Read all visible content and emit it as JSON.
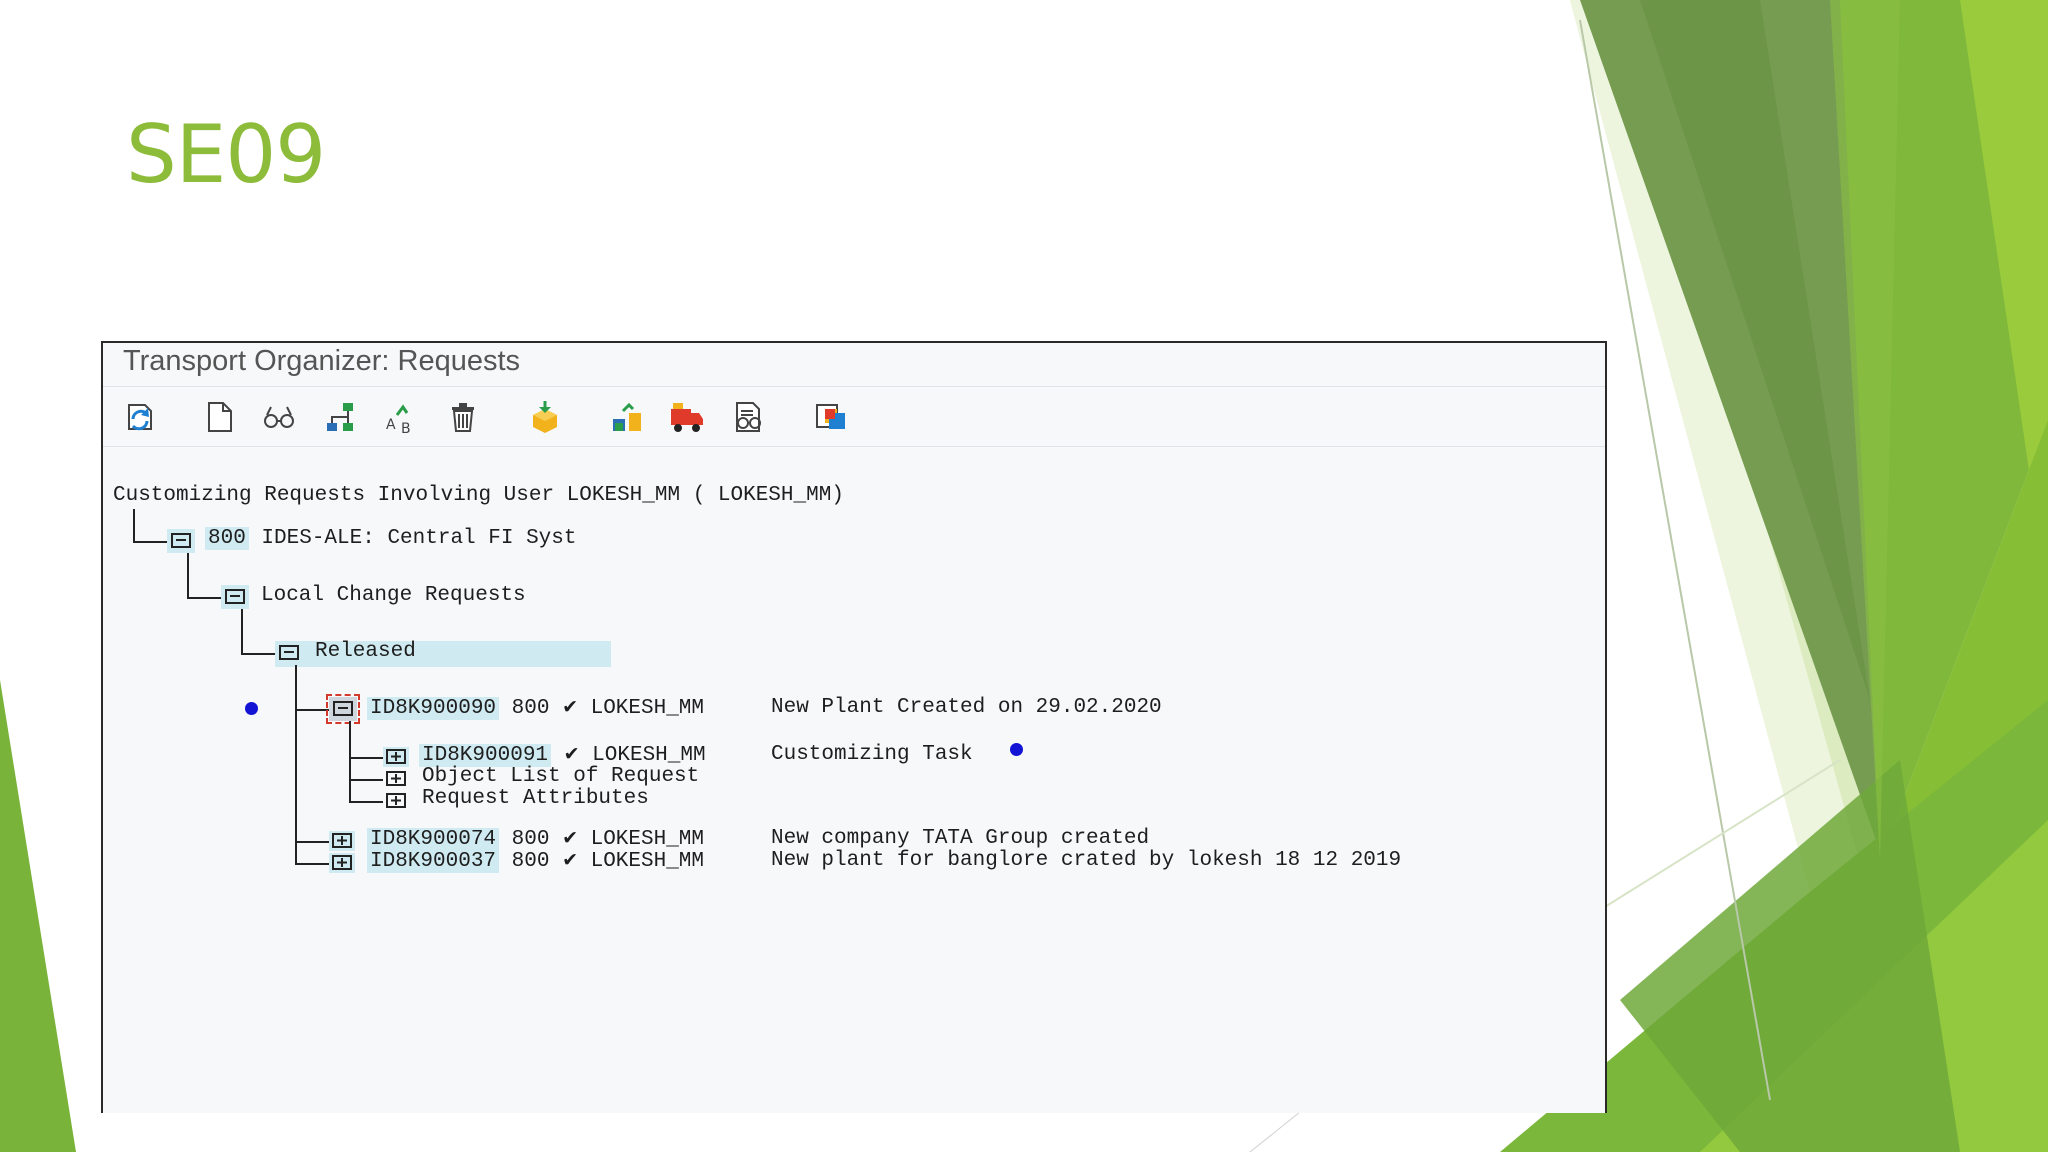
{
  "slide": {
    "title": "SE09",
    "accent_color": "#8cbc3a"
  },
  "window": {
    "title": "Transport Organizer: Requests",
    "toolbar": [
      {
        "name": "refresh-icon"
      },
      {
        "name": "create-icon"
      },
      {
        "name": "display-icon"
      },
      {
        "name": "hierarchy-icon"
      },
      {
        "name": "rename-icon"
      },
      {
        "name": "delete-icon"
      },
      {
        "name": "release-icon"
      },
      {
        "name": "transport-icon"
      },
      {
        "name": "truck-icon"
      },
      {
        "name": "compare-icon"
      },
      {
        "name": "copy-icon"
      }
    ]
  },
  "tree": {
    "header": "Customizing Requests Involving User LOKESH_MM ( LOKESH_MM)",
    "client": {
      "id": "800",
      "label": "IDES-ALE: Central FI Syst"
    },
    "local": "Local Change Requests",
    "released": "Released",
    "selected_request": {
      "id": "ID8K900090",
      "client": "800",
      "check": "✔",
      "user": "LOKESH_MM",
      "desc": "New Plant Created on 29.02.2020"
    },
    "task": {
      "id": "ID8K900091",
      "check": "✔",
      "user": "LOKESH_MM",
      "desc": "Customizing Task"
    },
    "object_list": "Object List of Request",
    "request_attributes": "Request Attributes",
    "requests": [
      {
        "id": "ID8K900074",
        "client": "800",
        "check": "✔",
        "user": "LOKESH_MM",
        "desc": "New company TATA Group created"
      },
      {
        "id": "ID8K900037",
        "client": "800",
        "check": "✔",
        "user": "LOKESH_MM",
        "desc": "New plant for banglore crated by lokesh 18 12 2019"
      }
    ]
  }
}
